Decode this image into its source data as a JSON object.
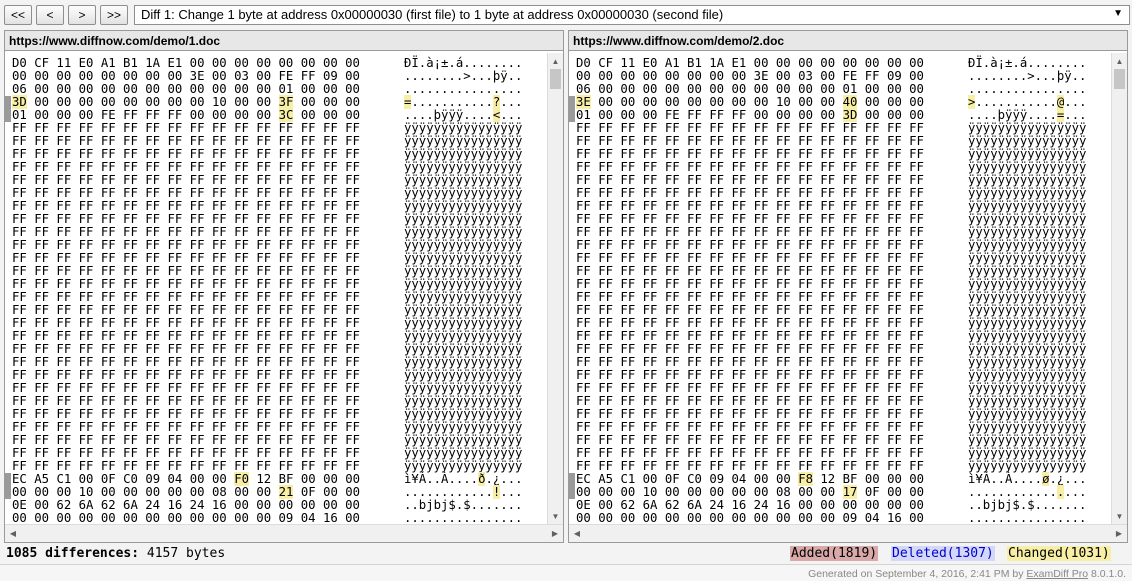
{
  "toolbar": {
    "first_label": "<<",
    "prev_label": "<",
    "next_label": ">",
    "last_label": ">>",
    "diff_select": "Diff 1: Change 1 byte at address 0x00000030 (first file) to 1 byte at address 0x00000030 (second file)",
    "dropdown_icon": "chevron-down-icon"
  },
  "left_pane": {
    "title": "https://www.diffnow.com/demo/1.doc",
    "hex_top": [
      "D0 CF 11 E0 A1 B1 1A E1 00 00 00 00 00 00 00 00",
      "00 00 00 00 00 00 00 00 3E 00 03 00 FE FF 09 00",
      "06 00 00 00 00 00 00 00 00 00 00 00 01 00 00 00",
      "3D 00 00 00 00 00 00 00 00 10 00 00 3F 00 00 00",
      "01 00 00 00 FE FF FF FF 00 00 00 00 3C 00 00 00"
    ],
    "ascii_top": [
      "ÐÏ.à¡±.á........",
      "........>...þÿ..",
      "................",
      "=...........?...",
      "....þÿÿÿ....<..."
    ],
    "hex_bottom": [
      "EC A5 C1 00 0F C0 09 04 00 00 F0 12 BF 00 00 00",
      "00 00 00 10 00 00 00 00 00 08 00 00 21 0F 00 00",
      "0E 00 62 6A 62 6A 24 16 24 16 00 00 00 00 00 00",
      "00 00 00 00 00 00 00 00 00 00 00 00 09 04 16 00"
    ],
    "ascii_bottom": [
      "ì¥Á..À....ð.¿...",
      "............!...",
      "..bjbj$.$.......",
      "................"
    ]
  },
  "right_pane": {
    "title": "https://www.diffnow.com/demo/2.doc",
    "hex_top": [
      "D0 CF 11 E0 A1 B1 1A E1 00 00 00 00 00 00 00 00",
      "00 00 00 00 00 00 00 00 3E 00 03 00 FE FF 09 00",
      "06 00 00 00 00 00 00 00 00 00 00 00 01 00 00 00",
      "3E 00 00 00 00 00 00 00 00 10 00 00 40 00 00 00",
      "01 00 00 00 FE FF FF FF 00 00 00 00 3D 00 00 00"
    ],
    "ascii_top": [
      "ÐÏ.à¡±.á........",
      "........>...þÿ..",
      "................",
      ">...........@...",
      "....þÿÿÿ....=..."
    ],
    "hex_bottom": [
      "EC A5 C1 00 0F C0 09 04 00 00 F8 12 BF 00 00 00",
      "00 00 00 10 00 00 00 00 00 08 00 00 17 0F 00 00",
      "0E 00 62 6A 62 6A 24 16 24 16 00 00 00 00 00 00",
      "00 00 00 00 00 00 00 00 00 00 00 00 09 04 16 00"
    ],
    "ascii_bottom": [
      "ì¥Á..À....ø.¿...",
      "................",
      "..bjbj$.$.......",
      "................"
    ]
  },
  "ff_hex_line": "FF FF FF FF FF FF FF FF FF FF FF FF FF FF FF FF",
  "ff_ascii_line": "ÿÿÿÿÿÿÿÿÿÿÿÿÿÿÿÿ",
  "ff_line_count": 27,
  "status": {
    "differences": "1085 differences:",
    "bytes": "4157 bytes",
    "added": "Added(1819)",
    "deleted": "Deleted(1307)",
    "changed": "Changed(1031)"
  },
  "colors": {
    "added": "#d9a8a8",
    "deleted": "#d4d8f8",
    "deleted_text": "#0000cc",
    "changed": "#f8efa6",
    "highlight": "#f8efa6"
  },
  "footer": {
    "prefix": "Generated on September 4, 2016, 2:41 PM by",
    "product": "ExamDiff Pro",
    "version": "8.0.1.0."
  }
}
